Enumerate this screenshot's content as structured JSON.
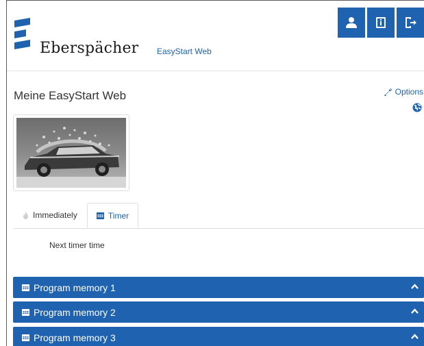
{
  "brand": {
    "name": "Eberspächer",
    "app_title": "EasyStart Web"
  },
  "header_buttons": [
    {
      "icon": "user-icon"
    },
    {
      "icon": "info-book-icon"
    },
    {
      "icon": "logout-icon"
    }
  ],
  "page": {
    "title": "Meine EasyStart Web",
    "options_label": "Options"
  },
  "tabs": {
    "immediately_label": "Immediately",
    "timer_label": "Timer",
    "active": "Timer"
  },
  "timer": {
    "next_timer_label": "Next timer time"
  },
  "program_memories": [
    {
      "label": "Program memory 1"
    },
    {
      "label": "Program memory 2"
    },
    {
      "label": "Program memory 3"
    }
  ],
  "colors": {
    "accent": "#1e62b0",
    "text": "#333333",
    "border": "#dddddd"
  }
}
